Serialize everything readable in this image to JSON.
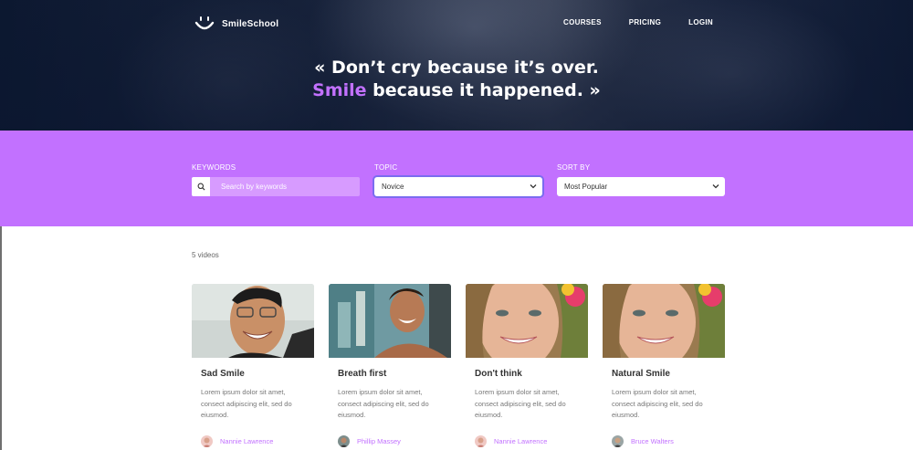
{
  "brand": {
    "name": "SmileSchool",
    "accent": "#c271ff"
  },
  "nav": {
    "items": [
      "COURSES",
      "PRICING",
      "LOGIN"
    ]
  },
  "hero": {
    "line1": "« Don’t cry because it’s over.",
    "line2_accent": "Smile",
    "line2_rest": " because it happened. »"
  },
  "filters": {
    "keywords": {
      "label": "KEYWORDS",
      "placeholder": "Search by keywords",
      "icon": "search-icon"
    },
    "topic": {
      "label": "TOPIC",
      "selected": "Novice"
    },
    "sort": {
      "label": "SORT BY",
      "selected": "Most Popular"
    }
  },
  "results": {
    "count_text": "5 videos"
  },
  "cards": [
    {
      "title": "Sad Smile",
      "text": "Lorem ipsum dolor sit amet, consect adipiscing elit, sed do eiusmod.",
      "author": "Nannie Lawrence"
    },
    {
      "title": "Breath first",
      "text": "Lorem ipsum dolor sit amet, consect adipiscing elit, sed do eiusmod.",
      "author": "Phillip Massey"
    },
    {
      "title": "Don't think",
      "text": "Lorem ipsum dolor sit amet, consect adipiscing elit, sed do eiusmod.",
      "author": "Nannie Lawrence"
    },
    {
      "title": "Natural Smile",
      "text": "Lorem ipsum dolor sit amet, consect adipiscing elit, sed do eiusmod.",
      "author": "Bruce Walters"
    }
  ]
}
